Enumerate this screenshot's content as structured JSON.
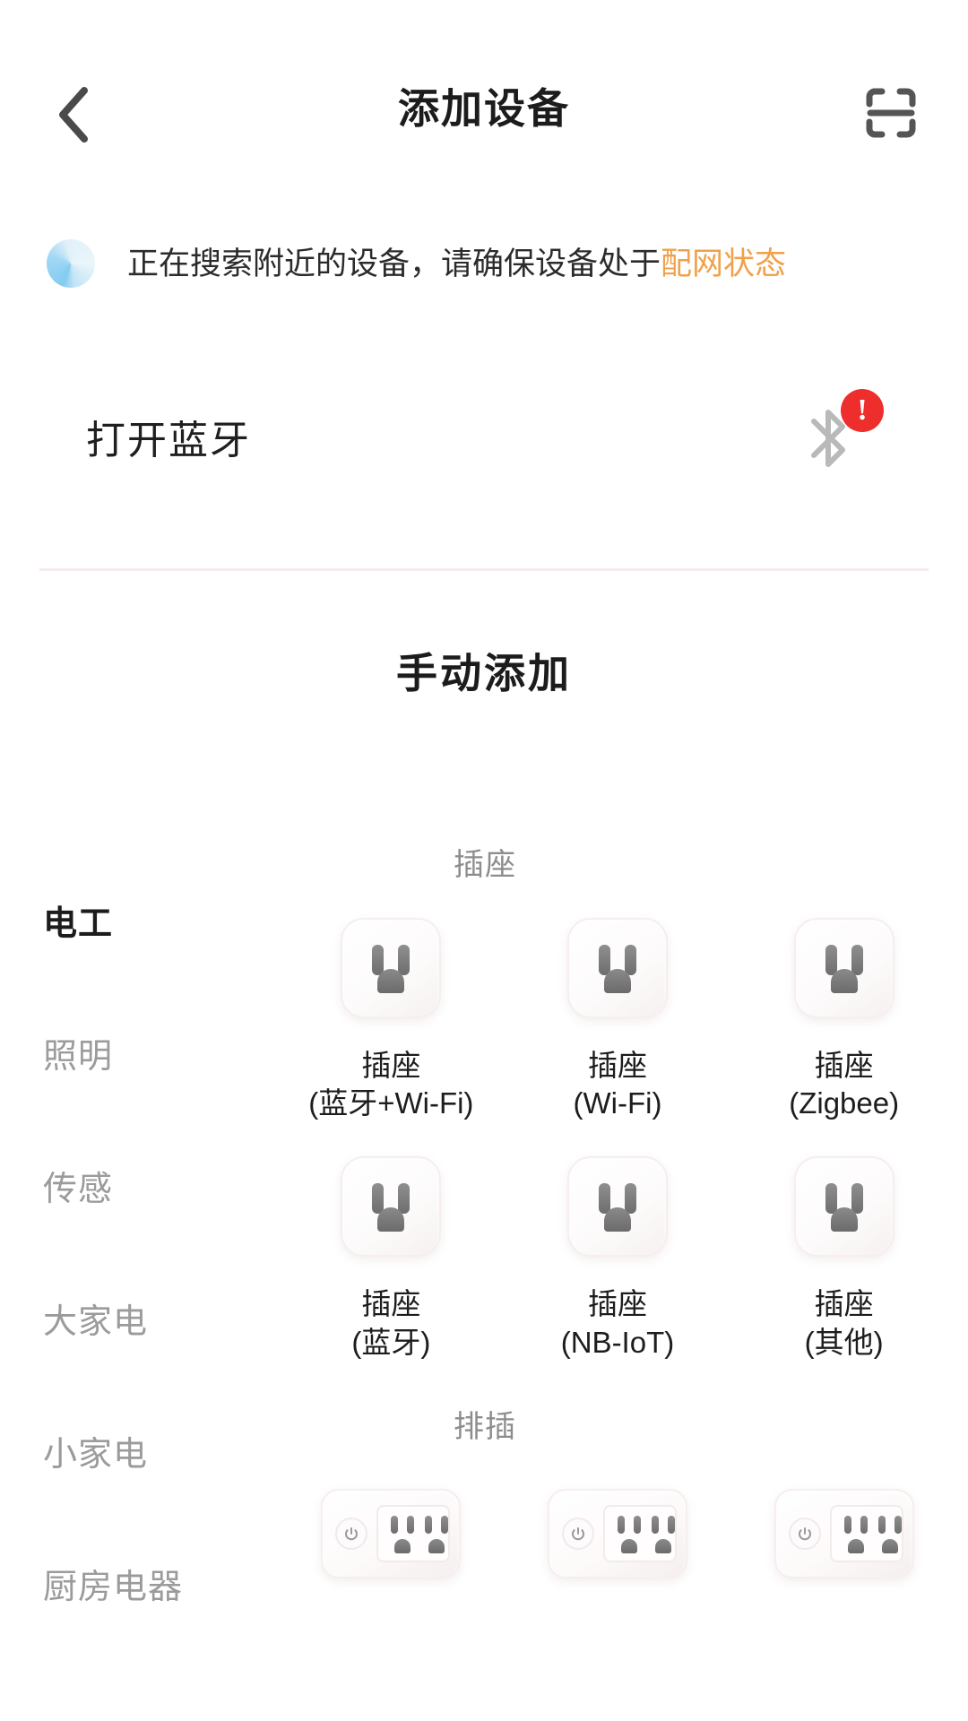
{
  "header": {
    "title": "添加设备",
    "back_icon": "chevron-left-icon",
    "scan_icon": "scan-qr-icon"
  },
  "status": {
    "spinner_icon": "loading-spinner-icon",
    "text_before": "正在搜索附近的设备，请确保设备处于",
    "text_highlight": "配网状态",
    "highlight_color": "#f0a14b"
  },
  "bluetooth_card": {
    "label": "打开蓝牙",
    "icon": "bluetooth-icon",
    "badge": "!",
    "badge_color": "#ee2d2d"
  },
  "manual": {
    "heading": "手动添加"
  },
  "sidebar": {
    "items": [
      {
        "label": "电工",
        "active": true
      },
      {
        "label": "照明",
        "active": false
      },
      {
        "label": "传感",
        "active": false
      },
      {
        "label": "大家电",
        "active": false
      },
      {
        "label": "小家电",
        "active": false
      },
      {
        "label": "厨房电器",
        "active": false
      }
    ]
  },
  "sections": [
    {
      "title": "插座",
      "art": "wall-socket",
      "items": [
        {
          "name": "插座",
          "variant": "(蓝牙+Wi-Fi)"
        },
        {
          "name": "插座",
          "variant": "(Wi-Fi)"
        },
        {
          "name": "插座",
          "variant": "(Zigbee)"
        },
        {
          "name": "插座",
          "variant": "(蓝牙)"
        },
        {
          "name": "插座",
          "variant": "(NB-IoT)"
        },
        {
          "name": "插座",
          "variant": "(其他)"
        }
      ]
    },
    {
      "title": "排插",
      "art": "power-strip",
      "items": [
        {
          "name": "",
          "variant": ""
        },
        {
          "name": "",
          "variant": ""
        },
        {
          "name": "",
          "variant": ""
        }
      ]
    }
  ]
}
